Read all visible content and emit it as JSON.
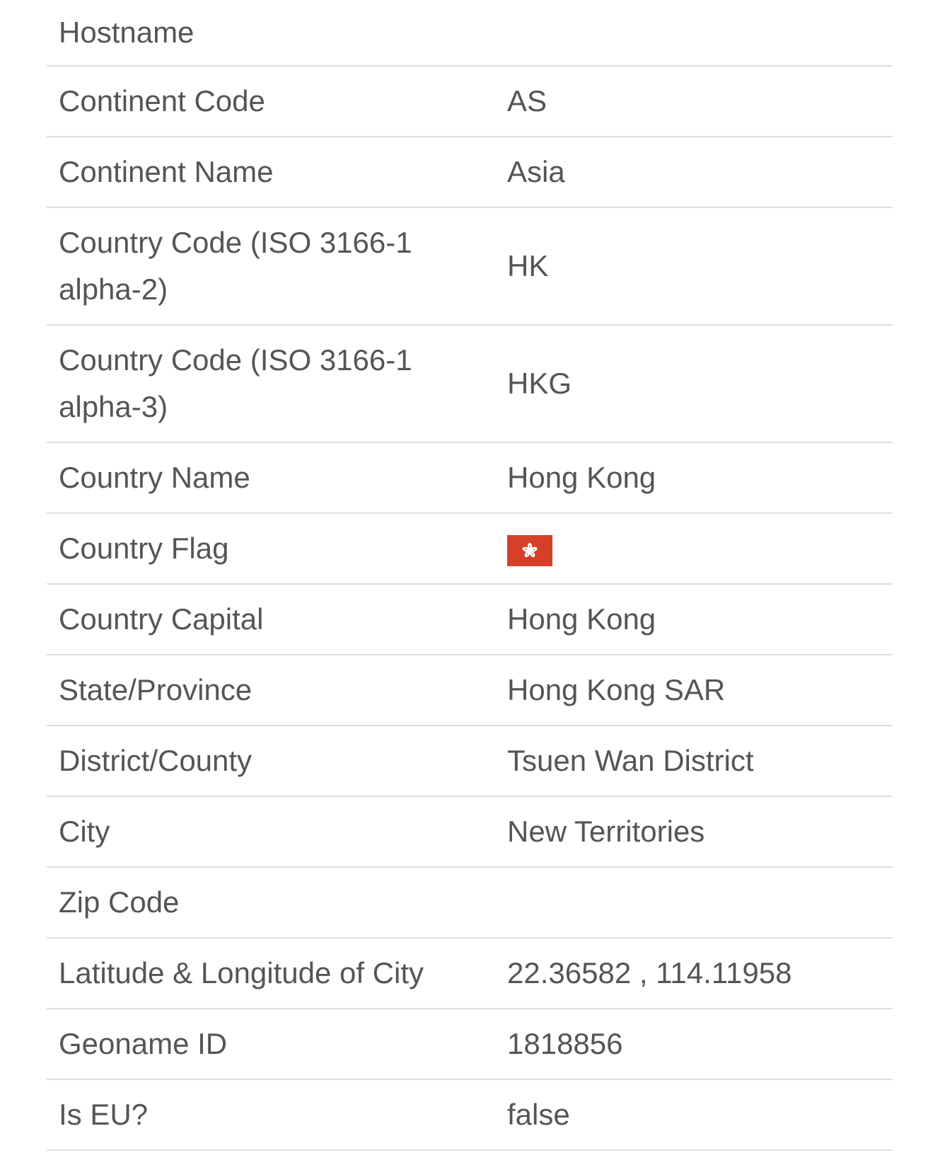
{
  "rows": [
    {
      "label": "Hostname",
      "value": ""
    },
    {
      "label": "Continent Code",
      "value": "AS"
    },
    {
      "label": "Continent Name",
      "value": "Asia"
    },
    {
      "label": "Country Code (ISO 3166-1 alpha-2)",
      "value": "HK"
    },
    {
      "label": "Country Code (ISO 3166-1 alpha-3)",
      "value": "HKG"
    },
    {
      "label": "Country Name",
      "value": "Hong Kong"
    },
    {
      "label": "Country Flag",
      "value_icon": "hong-kong-flag-icon"
    },
    {
      "label": "Country Capital",
      "value": "Hong Kong"
    },
    {
      "label": "State/Province",
      "value": "Hong Kong SAR"
    },
    {
      "label": "District/County",
      "value": "Tsuen Wan District"
    },
    {
      "label": "City",
      "value": "New Territories"
    },
    {
      "label": "Zip Code",
      "value": ""
    },
    {
      "label": "Latitude & Longitude of City",
      "value": "22.36582 , 114.11958"
    },
    {
      "label": "Geoname ID",
      "value": "1818856"
    },
    {
      "label": "Is EU?",
      "value": "false"
    }
  ],
  "colors": {
    "text": "#555555",
    "divider": "#dddddd",
    "flag_red": "#d6402a"
  }
}
